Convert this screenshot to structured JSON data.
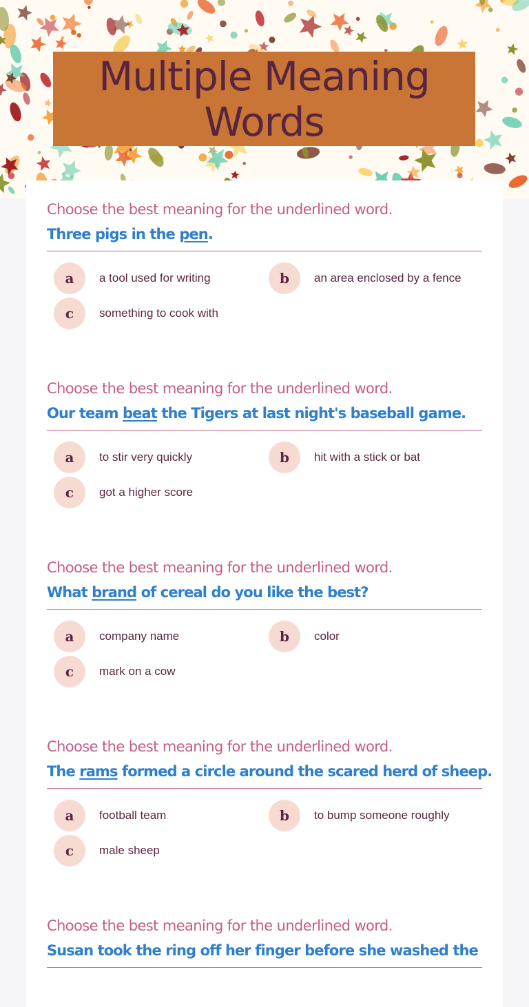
{
  "header": {
    "title": "Multiple Meaning Words"
  },
  "colors": {
    "title_box": "#c87535",
    "title_text": "#58243f",
    "instruction": "#c45d86",
    "sentence": "#2e7fcc",
    "option_circle": "#f7dbd3",
    "option_text": "#5a2741"
  },
  "questions": [
    {
      "instruction": "Choose the best meaning for the underlined word.",
      "sentence_before": "Three pigs in the ",
      "underlined": "pen",
      "sentence_after": ".",
      "options": [
        {
          "letter": "a",
          "text": "a tool used for writing"
        },
        {
          "letter": "b",
          "text": "an area enclosed by a fence"
        },
        {
          "letter": "c",
          "text": "something to cook with"
        }
      ]
    },
    {
      "instruction": "Choose the best meaning for the underlined word.",
      "sentence_before": "Our team ",
      "underlined": "beat",
      "sentence_after": " the Tigers at last night's baseball game.",
      "options": [
        {
          "letter": "a",
          "text": "to stir very quickly"
        },
        {
          "letter": "b",
          "text": "hit with a stick or bat"
        },
        {
          "letter": "c",
          "text": "got a higher score"
        }
      ]
    },
    {
      "instruction": "Choose the best meaning for the underlined word.",
      "sentence_before": "What ",
      "underlined": "brand",
      "sentence_after": " of cereal do you like the best?",
      "options": [
        {
          "letter": "a",
          "text": "company name"
        },
        {
          "letter": "b",
          "text": "color"
        },
        {
          "letter": "c",
          "text": "mark on a cow"
        }
      ]
    },
    {
      "instruction": "Choose the best meaning for the underlined word.",
      "sentence_before": "The ",
      "underlined": "rams",
      "sentence_after": " formed a circle around the scared herd of sheep.",
      "options": [
        {
          "letter": "a",
          "text": "football team"
        },
        {
          "letter": "b",
          "text": "to bump someone roughly"
        },
        {
          "letter": "c",
          "text": "male sheep"
        }
      ]
    },
    {
      "instruction": "Choose the best meaning for the underlined word.",
      "sentence_before": "Susan took the ring off her finger before she washed the",
      "underlined": "",
      "sentence_after": ""
    }
  ]
}
